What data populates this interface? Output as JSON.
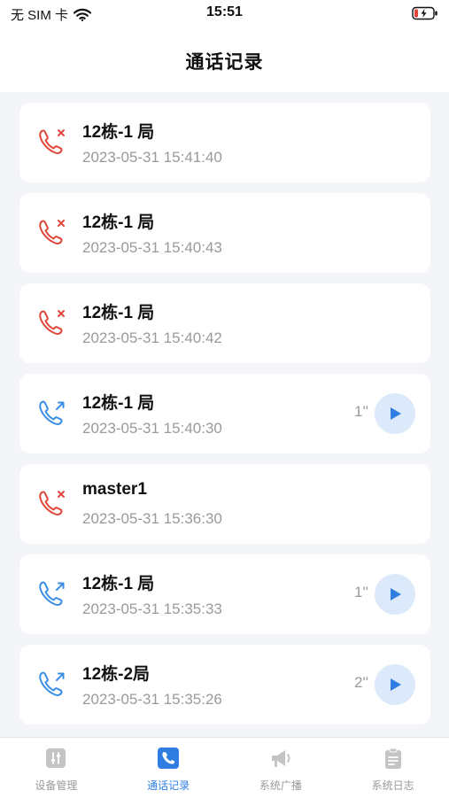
{
  "status_bar": {
    "carrier": "无 SIM 卡",
    "time": "15:51"
  },
  "header": {
    "title": "通话记录"
  },
  "calls": [
    {
      "type": "missed",
      "name": "12栋-1 局",
      "time": "2023-05-31 15:41:40",
      "duration": ""
    },
    {
      "type": "missed",
      "name": "12栋-1 局",
      "time": "2023-05-31 15:40:43",
      "duration": ""
    },
    {
      "type": "missed",
      "name": "12栋-1 局",
      "time": "2023-05-31 15:40:42",
      "duration": ""
    },
    {
      "type": "outgoing",
      "name": "12栋-1 局",
      "time": "2023-05-31 15:40:30",
      "duration": "1''"
    },
    {
      "type": "missed",
      "name": "master1",
      "time": "2023-05-31 15:36:30",
      "duration": ""
    },
    {
      "type": "outgoing",
      "name": "12栋-1 局",
      "time": "2023-05-31 15:35:33",
      "duration": "1''"
    },
    {
      "type": "outgoing",
      "name": "12栋-2局",
      "time": "2023-05-31 15:35:26",
      "duration": "2''"
    }
  ],
  "tabs": [
    {
      "label": "设备管理",
      "icon": "device-manage-icon",
      "active": false
    },
    {
      "label": "通话记录",
      "icon": "call-log-icon",
      "active": true
    },
    {
      "label": "系统广播",
      "icon": "broadcast-icon",
      "active": false
    },
    {
      "label": "系统日志",
      "icon": "system-log-icon",
      "active": false
    }
  ],
  "colors": {
    "accent": "#2f7de1",
    "missed": "#e0463a",
    "outgoing": "#3a8ee6",
    "inactive_tab": "#c4c4c4"
  }
}
